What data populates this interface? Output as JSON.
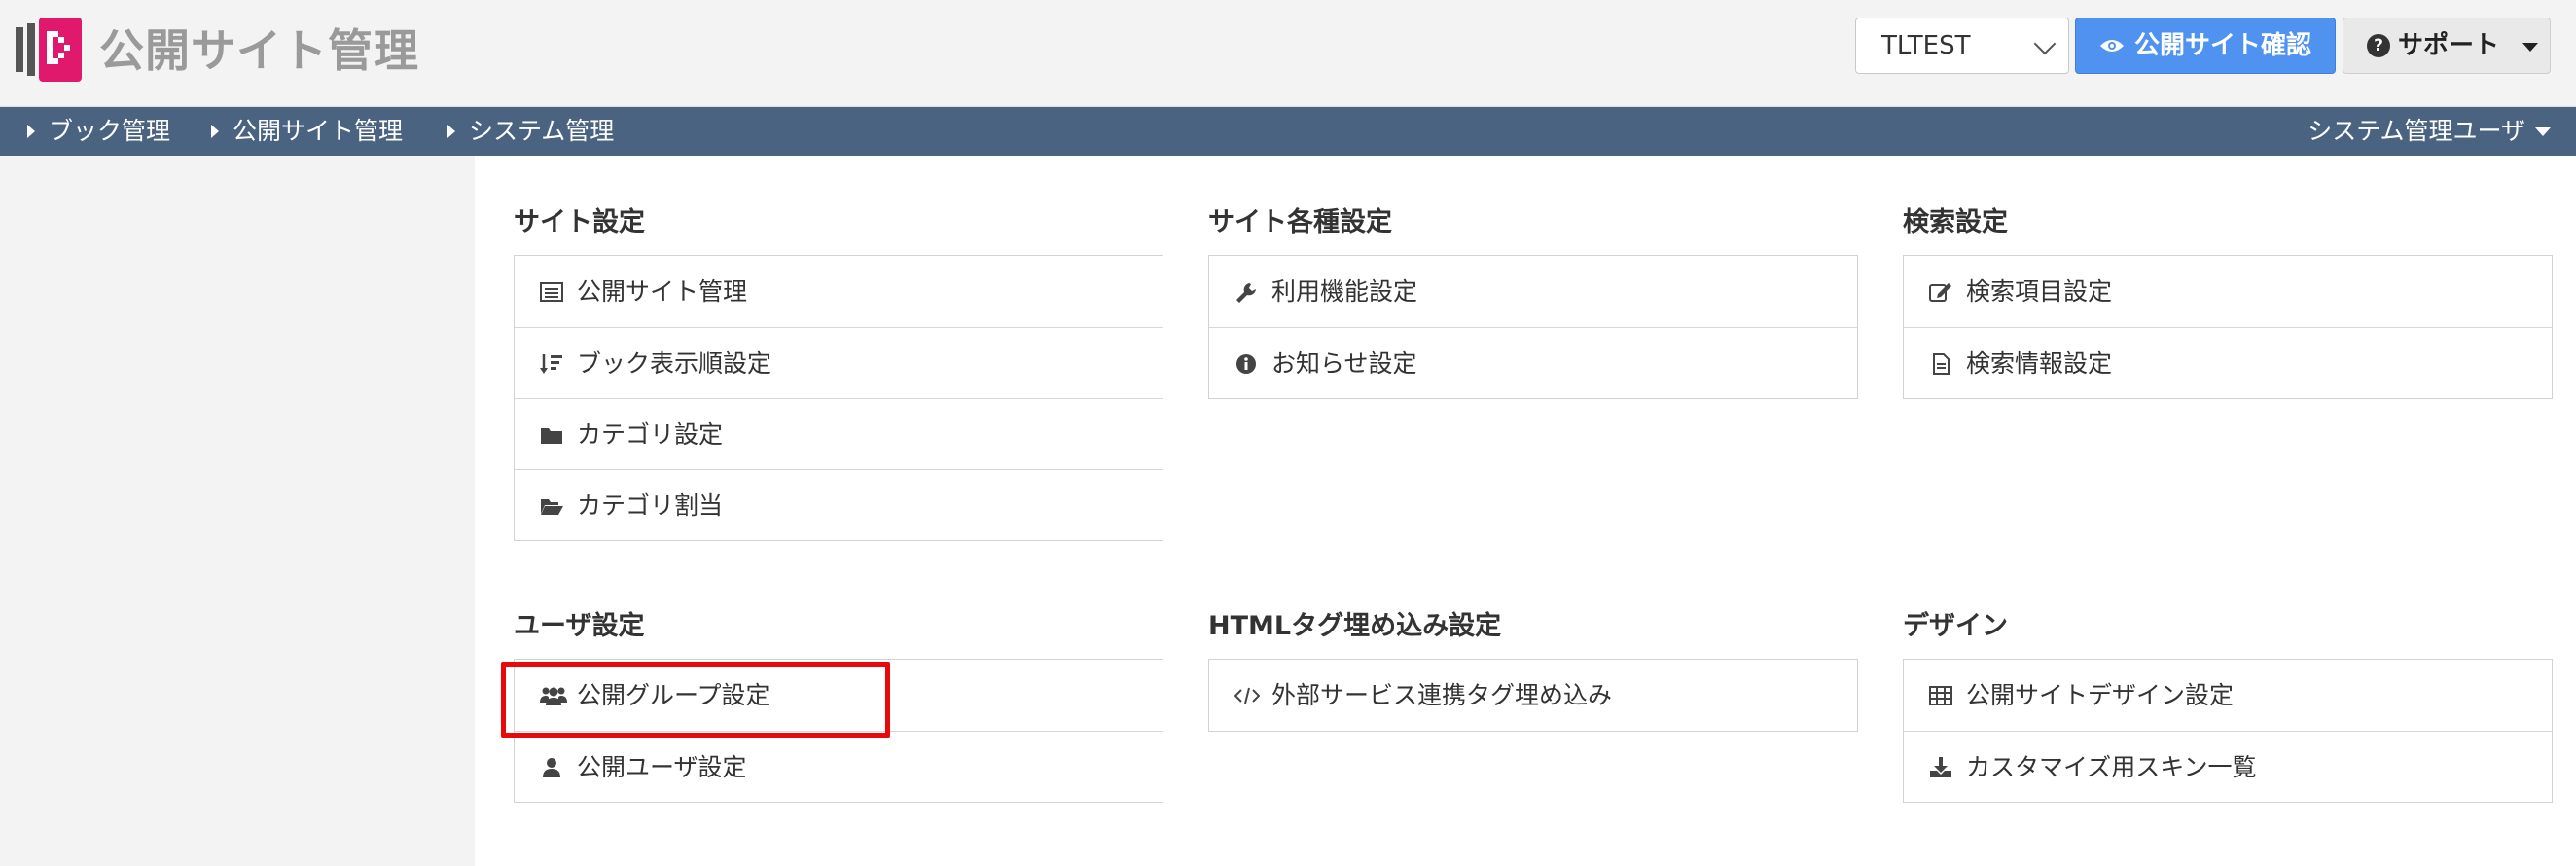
{
  "app": {
    "title": "公開サイト管理"
  },
  "header": {
    "site_select": {
      "value": "TLTEST"
    },
    "public_button": "公開サイト確認",
    "support_button": "サポート"
  },
  "nav": {
    "items": [
      "ブック管理",
      "公開サイト管理",
      "システム管理"
    ],
    "user": "システム管理ユーザ"
  },
  "sections": [
    {
      "title": "サイト設定",
      "items": [
        "公開サイト管理",
        "ブック表示順設定",
        "カテゴリ設定",
        "カテゴリ割当"
      ]
    },
    {
      "title": "サイト各種設定",
      "items": [
        "利用機能設定",
        "お知らせ設定"
      ]
    },
    {
      "title": "検索設定",
      "items": [
        "検索項目設定",
        "検索情報設定"
      ]
    },
    {
      "title": "ユーザ設定",
      "items": [
        "公開グループ設定",
        "公開ユーザ設定"
      ]
    },
    {
      "title": "HTMLタグ埋め込み設定",
      "items": [
        "外部サービス連携タグ埋め込み"
      ]
    },
    {
      "title": "デザイン",
      "items": [
        "公開サイトデザイン設定",
        "カスタマイズ用スキン一覧"
      ]
    }
  ],
  "colors": {
    "nav_bg": "#4a6381",
    "primary": "#4f92f0",
    "highlight": "#e80a0a",
    "logo": "#e0196d"
  }
}
